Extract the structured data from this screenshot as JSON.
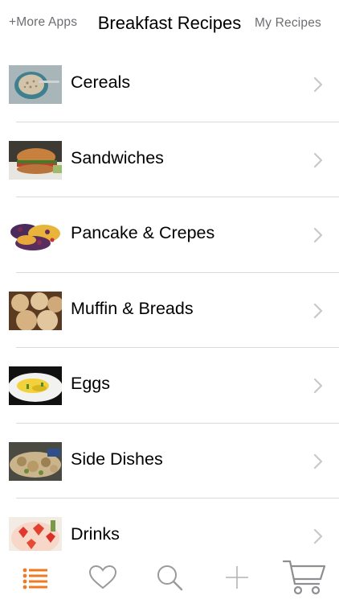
{
  "header": {
    "more_apps": "+More Apps",
    "title": "Breakfast Recipes",
    "my_recipes": "My Recipes"
  },
  "categories": [
    {
      "label": "Cereals",
      "icon": "cereal-bowl-photo"
    },
    {
      "label": "Sandwiches",
      "icon": "sandwich-photo"
    },
    {
      "label": "Pancake & Crepes",
      "icon": "pancake-photo"
    },
    {
      "label": "Muffin & Breads",
      "icon": "muffin-photo"
    },
    {
      "label": "Eggs",
      "icon": "eggs-photo"
    },
    {
      "label": "Side Dishes",
      "icon": "side-dish-photo"
    },
    {
      "label": "Drinks",
      "icon": "drinks-photo"
    }
  ],
  "tabbar": {
    "items": [
      {
        "icon": "list-icon",
        "active": true
      },
      {
        "icon": "heart-icon",
        "active": false
      },
      {
        "icon": "search-icon",
        "active": false
      },
      {
        "icon": "plus-icon",
        "active": false
      },
      {
        "icon": "cart-icon",
        "active": false
      }
    ]
  },
  "colors": {
    "accent": "#f07a23",
    "icon_gray": "#9a9a9e",
    "header_gray": "#6d6d72",
    "divider": "#d9d9dd",
    "chevron": "#c7c7cc"
  }
}
